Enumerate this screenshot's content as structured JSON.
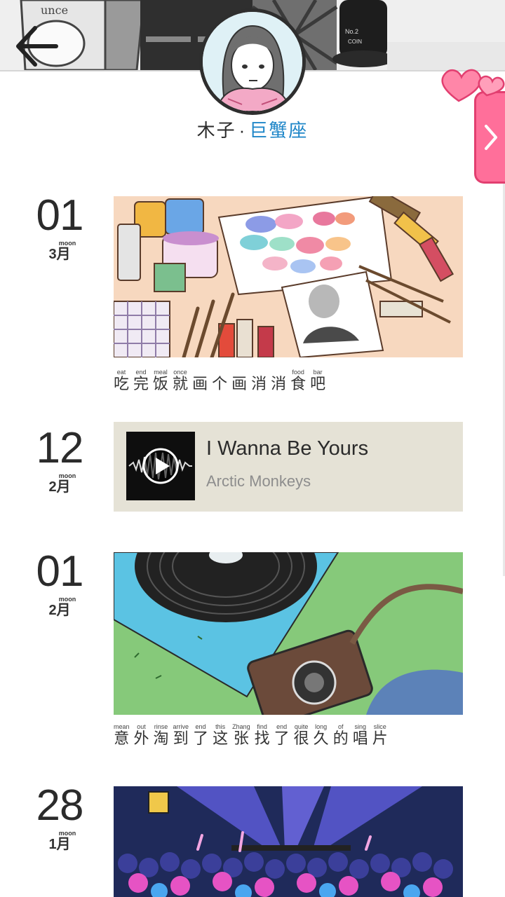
{
  "header": {
    "back_icon": "arrow-left-icon",
    "name": "木子",
    "separator": "·",
    "zodiac": "巨蟹座",
    "side_tab_icon": "chevron-right-icon",
    "accent_pink": "#ff6f9a",
    "accent_blue": "#1e86c8"
  },
  "timeline": [
    {
      "day": "01",
      "moon_label": "moon",
      "month": "3月",
      "type": "image",
      "image_desc": "painting-supplies-illustration",
      "caption": [
        {
          "en": "eat",
          "zh": "吃"
        },
        {
          "en": "end",
          "zh": "完"
        },
        {
          "en": "meal",
          "zh": "饭"
        },
        {
          "en": "once",
          "zh": "就"
        },
        {
          "en": "",
          "zh": "画"
        },
        {
          "en": "",
          "zh": "个"
        },
        {
          "en": "",
          "zh": "画"
        },
        {
          "en": "",
          "zh": "消"
        },
        {
          "en": "",
          "zh": "消"
        },
        {
          "en": "food",
          "zh": "食"
        },
        {
          "en": "bar",
          "zh": "吧"
        }
      ]
    },
    {
      "day": "12",
      "moon_label": "moon",
      "month": "2月",
      "type": "music",
      "song_title": "I Wanna Be Yours",
      "artist": "Arctic Monkeys",
      "play_icon": "play-icon"
    },
    {
      "day": "01",
      "moon_label": "moon",
      "month": "2月",
      "type": "image",
      "image_desc": "vinyl-and-camera-illustration",
      "caption": [
        {
          "en": "mean",
          "zh": "意"
        },
        {
          "en": "out",
          "zh": "外"
        },
        {
          "en": "rinse",
          "zh": "淘"
        },
        {
          "en": "arrive",
          "zh": "到"
        },
        {
          "en": "end",
          "zh": "了"
        },
        {
          "en": "this",
          "zh": "这"
        },
        {
          "en": "Zhang",
          "zh": "张"
        },
        {
          "en": "find",
          "zh": "找"
        },
        {
          "en": "end",
          "zh": "了"
        },
        {
          "en": "quite",
          "zh": "很"
        },
        {
          "en": "long",
          "zh": "久"
        },
        {
          "en": "of",
          "zh": "的"
        },
        {
          "en": "sing",
          "zh": "唱"
        },
        {
          "en": "slice",
          "zh": "片"
        }
      ]
    },
    {
      "day": "28",
      "moon_label": "moon",
      "month": "1月",
      "type": "image",
      "image_desc": "concert-crowd-illustration"
    }
  ]
}
